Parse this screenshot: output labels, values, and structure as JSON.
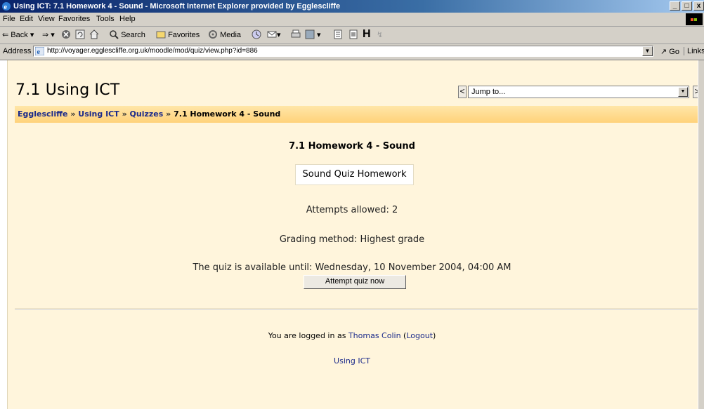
{
  "window": {
    "title": "Using ICT: 7.1 Homework 4 - Sound - Microsoft Internet Explorer provided by Egglescliffe",
    "buttons": [
      "_",
      "□",
      "x"
    ]
  },
  "menubar": {
    "items": [
      "File",
      "Edit",
      "View",
      "Favorites",
      "Tools",
      "Help"
    ]
  },
  "toolbar": {
    "back": "Back",
    "search": "Search",
    "favorites": "Favorites",
    "media": "Media"
  },
  "addressbar": {
    "label": "Address",
    "url": "http://voyager.egglescliffe.org.uk/moodle/mod/quiz/view.php?id=886",
    "go": "Go",
    "links": "Links"
  },
  "page": {
    "site_title": "7.1 Using ICT",
    "jump": {
      "prev": "<",
      "next": ">",
      "selected": "Jump to..."
    },
    "breadcrumb": {
      "items": [
        "Egglescliffe",
        "Using ICT",
        "Quizzes"
      ],
      "separator": "»",
      "current": "7.1 Homework 4 - Sound"
    },
    "quiz": {
      "name": "7.1 Homework 4 - Sound",
      "summary": "Sound Quiz Homework",
      "attempts": "Attempts allowed: 2",
      "grading": "Grading method: Highest grade",
      "available": "The quiz is available until: Wednesday, 10 November 2004, 04:00 AM",
      "attempt_button": "Attempt quiz now"
    },
    "footer": {
      "logged_in_prefix": "You are logged in as",
      "user": "Thomas Colin",
      "logout": "Logout",
      "home_link": "Using ICT"
    }
  },
  "colors": {
    "page_bg": "#fff5dc",
    "navbar_bg": "#ffd27a",
    "link": "#1b2a8a",
    "titlebar": "#0a246a"
  }
}
